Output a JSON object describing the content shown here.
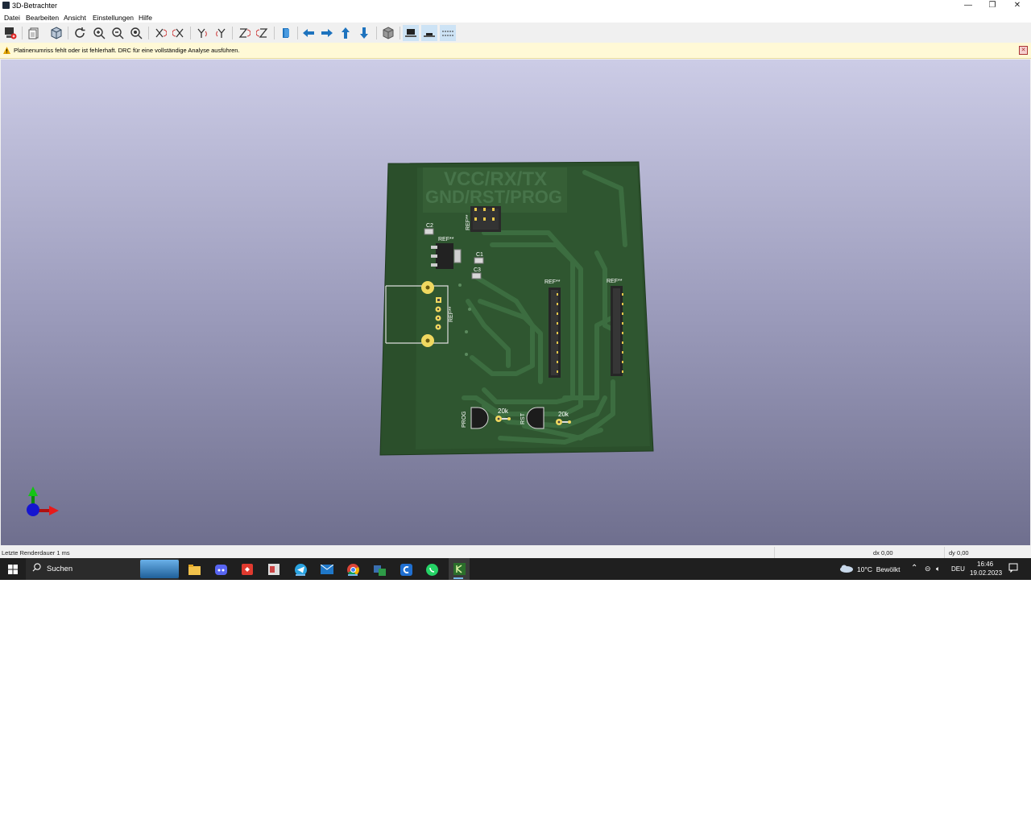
{
  "window": {
    "title": "3D-Betrachter",
    "controls": {
      "minimize": "—",
      "restore": "❐",
      "close": "✕"
    }
  },
  "menu": [
    "Datei",
    "Bearbeiten",
    "Ansicht",
    "Einstellungen",
    "Hilfe"
  ],
  "toolbar": {
    "buttons": [
      "export-icon",
      "copy-icon",
      "view-3d-icon",
      "refresh-icon",
      "zoom-in-icon",
      "zoom-out-icon",
      "zoom-fit-icon",
      "rotate-x-cw-icon",
      "rotate-x-ccw-icon",
      "rotate-y-cw-icon",
      "rotate-y-ccw-icon",
      "rotate-z-cw-icon",
      "rotate-z-ccw-icon",
      "flip-board-icon",
      "move-left-icon",
      "move-right-icon",
      "move-up-icon",
      "move-down-icon",
      "orthographic-icon",
      "render-mode-icon",
      "view-bottom-icon",
      "view-dots-icon"
    ]
  },
  "infobar": {
    "message": "Platinenumriss fehlt oder ist fehlerhaft. DRC für eine vollständige Analyse ausführen."
  },
  "board": {
    "silkscreen_line1": "VCC/RX/TX",
    "silkscreen_line2": "GND/RST/PROG",
    "labels": {
      "c2": "C2",
      "c1": "C1",
      "c3": "C3",
      "ref_top": "REF**",
      "ref_reg": "REF**",
      "ref_conn": "REF**",
      "ref_header1": "REF**",
      "ref_header2": "REF**",
      "prog": "PROG",
      "rst": "RST",
      "r1": "20k",
      "r2": "20k"
    },
    "colors": {
      "substrate": "#2b4f2b",
      "copper_trace": "#35603a",
      "pad": "#f0d860",
      "silk": "#ffffff"
    }
  },
  "status": {
    "render_time": "Letzte Renderdauer 1 ms",
    "dx": "dx 0,00",
    "dy": "dy 0,00"
  },
  "taskbar": {
    "search_label": "Suchen",
    "apps": [
      "file-explorer-icon",
      "discord-icon",
      "app-red-icon",
      "app-office-icon",
      "telegram-icon",
      "mail-icon",
      "chrome-icon",
      "app-teams-icon",
      "app-c-icon",
      "whatsapp-icon",
      "kicad-icon"
    ],
    "weather": "10°C  Bewölkt",
    "language": "DEU",
    "time": "16:46",
    "date": "19.02.2023"
  }
}
